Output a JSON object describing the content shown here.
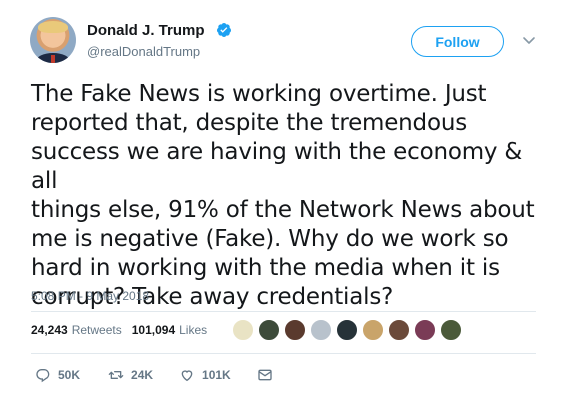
{
  "user": {
    "name": "Donald J. Trump",
    "handle": "@realDonaldTrump",
    "verified": true
  },
  "follow_label": "Follow",
  "tweet_text": "The Fake News is working overtime. Just\nreported that, despite the tremendous\nsuccess we are having with the economy & all\nthings else, 91% of the Network News about\nme is negative (Fake). Why do we work so\nhard in working with the media when it is\ncorrupt? Take away credentials?",
  "timestamp": "5:08 PM - 9 May 2018",
  "stats": {
    "retweets_count": "24,243",
    "retweets_label": "Retweets",
    "likes_count": "101,094",
    "likes_label": "Likes"
  },
  "likers_colors": [
    "#e9e3c4",
    "#3d4b3a",
    "#5a3a2e",
    "#b8c2cc",
    "#263238",
    "#c9a46a",
    "#6b4a3a",
    "#7a3b56",
    "#4b5a3a"
  ],
  "actions": {
    "replies": "50K",
    "retweets": "24K",
    "likes": "101K"
  },
  "colors": {
    "accent": "#1da1f2",
    "secondary_text": "#657786",
    "divider": "#e1e8ed"
  }
}
